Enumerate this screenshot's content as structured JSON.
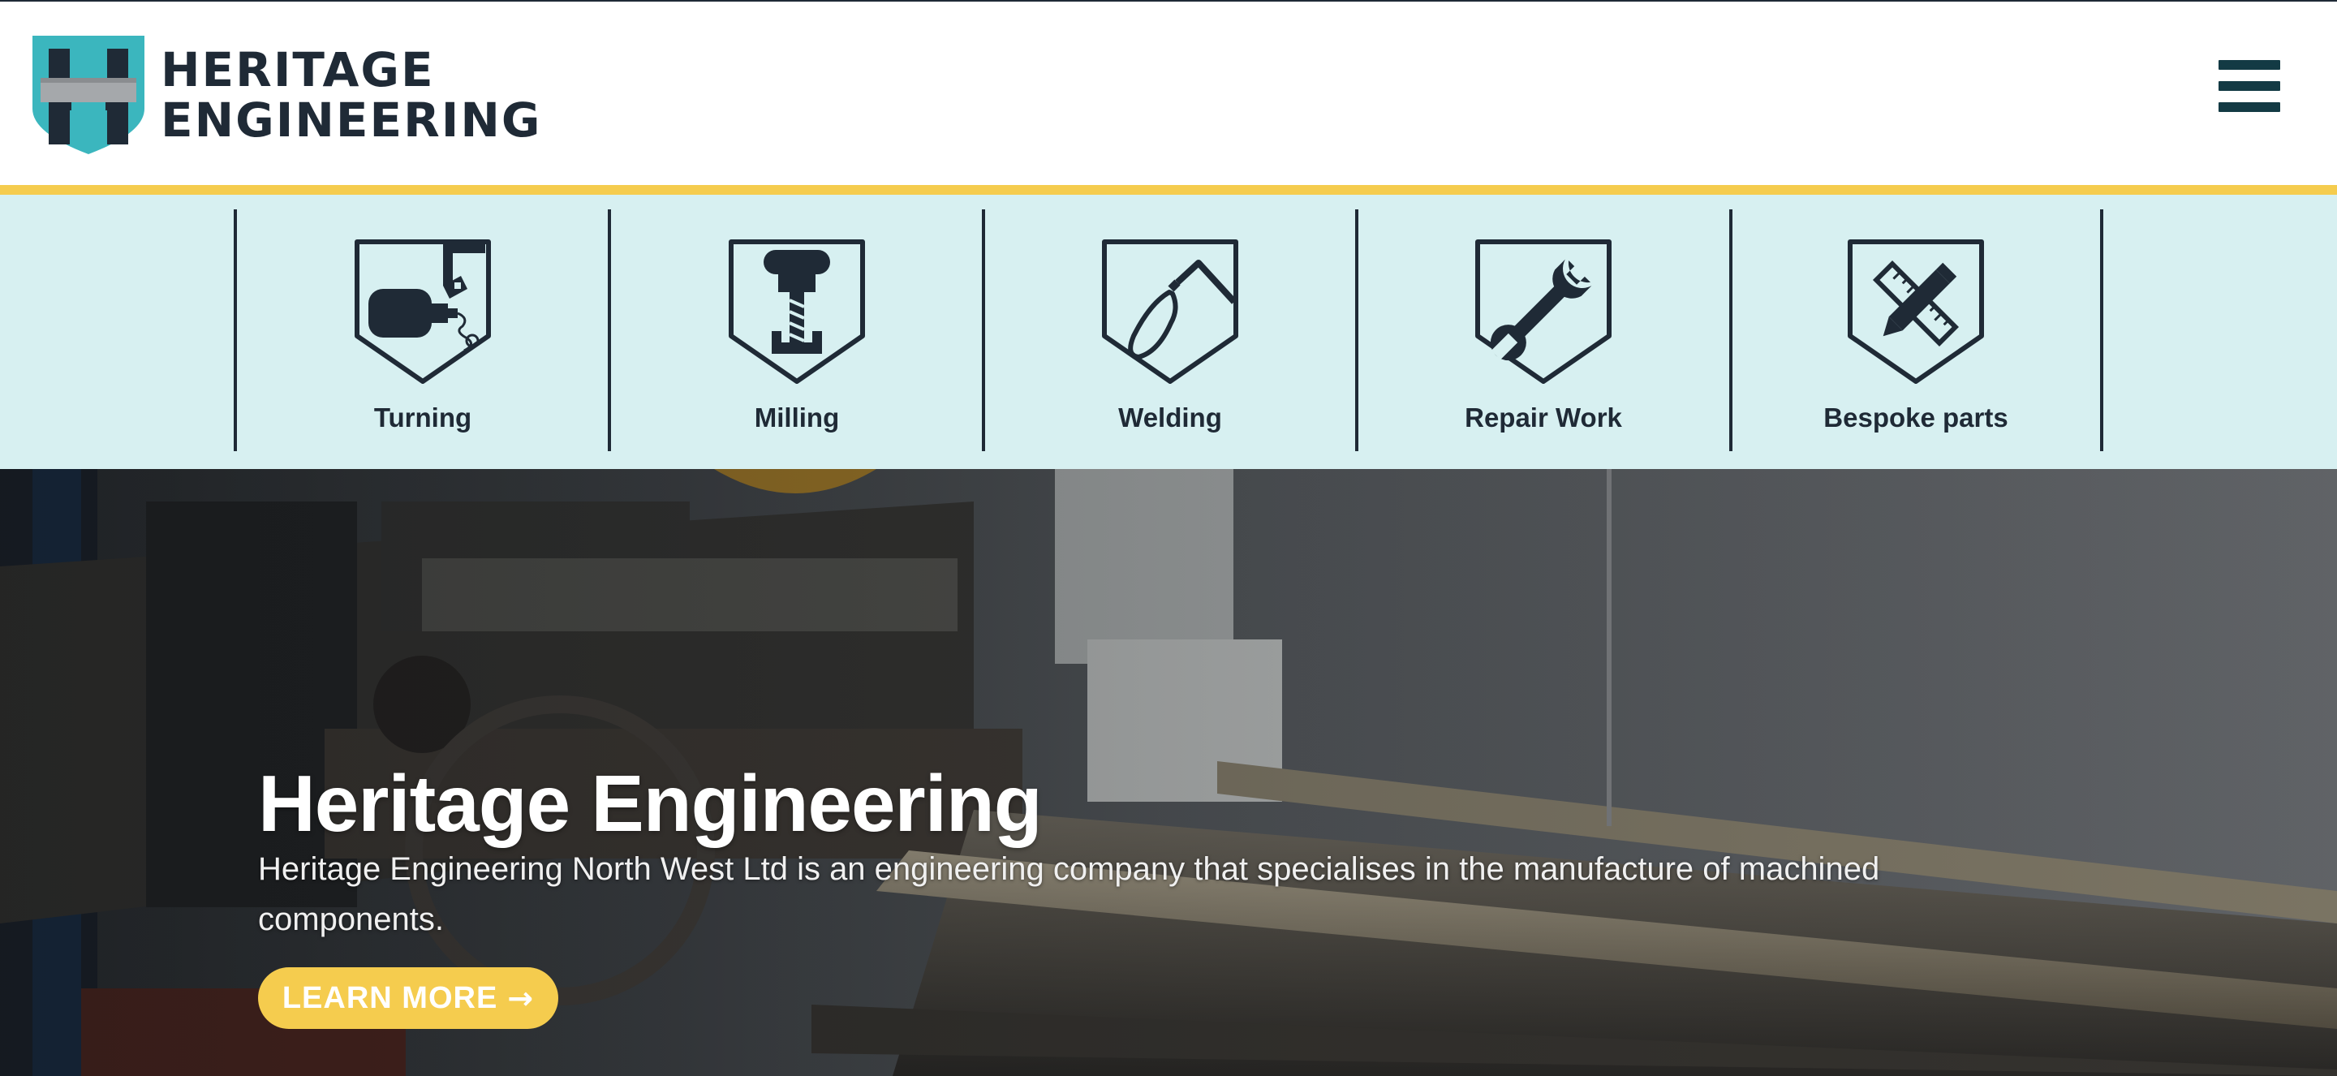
{
  "brand": {
    "name_line1": "HERITAGE",
    "name_line2": "ENGINEERING",
    "logo_icon": "h-shield-logo",
    "colors": {
      "teal": "#3bb6be",
      "navy": "#1f2a36",
      "gold": "#f5cc4e",
      "light_teal_bg": "#d7f0f1"
    }
  },
  "nav": {
    "menu_icon": "hamburger-menu-icon"
  },
  "services": [
    {
      "label": "Turning",
      "icon": "lathe-turning-icon"
    },
    {
      "label": "Milling",
      "icon": "milling-tool-icon"
    },
    {
      "label": "Welding",
      "icon": "welding-torch-icon"
    },
    {
      "label": "Repair Work",
      "icon": "wrench-icon"
    },
    {
      "label": "Bespoke parts",
      "icon": "ruler-pencil-icon"
    }
  ],
  "hero": {
    "title": "Heritage Engineering",
    "description": "Heritage Engineering North West Ltd is an engineering company that specialises in the manufacture of machined components.",
    "cta_label": "LEARN MORE",
    "cta_icon": "arrow-right-icon",
    "arrow_glyph": "→",
    "background": "lathe-machine-photo"
  }
}
